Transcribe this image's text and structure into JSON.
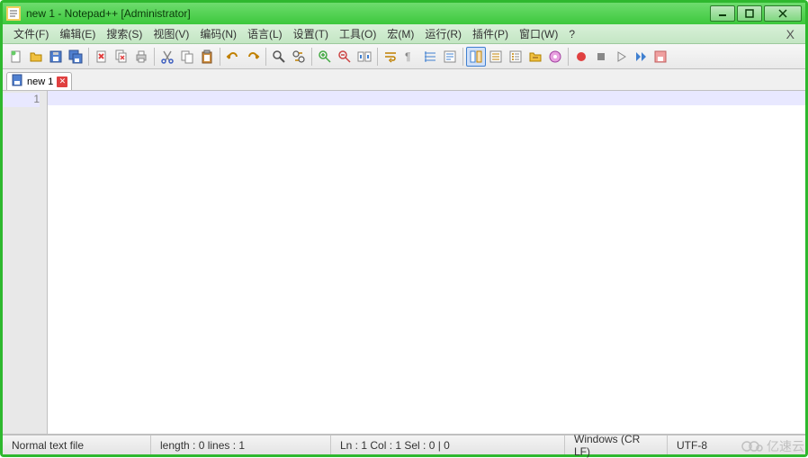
{
  "titlebar": {
    "text": "new 1 - Notepad++  [Administrator]"
  },
  "menu": {
    "file": "文件(F)",
    "edit": "编辑(E)",
    "search": "搜索(S)",
    "view": "视图(V)",
    "encoding": "编码(N)",
    "language": "语言(L)",
    "settings": "设置(T)",
    "tools": "工具(O)",
    "macro": "宏(M)",
    "run": "运行(R)",
    "plugins": "插件(P)",
    "window": "窗口(W)",
    "help": "?"
  },
  "tabs": [
    {
      "label": "new 1"
    }
  ],
  "gutter": {
    "line1": "1"
  },
  "status": {
    "filetype": "Normal text file",
    "length": "length : 0    lines : 1",
    "pos": "Ln : 1    Col : 1    Sel : 0 | 0",
    "eol": "Windows (CR LF)",
    "enc": "UTF-8"
  },
  "watermark": "亿速云"
}
